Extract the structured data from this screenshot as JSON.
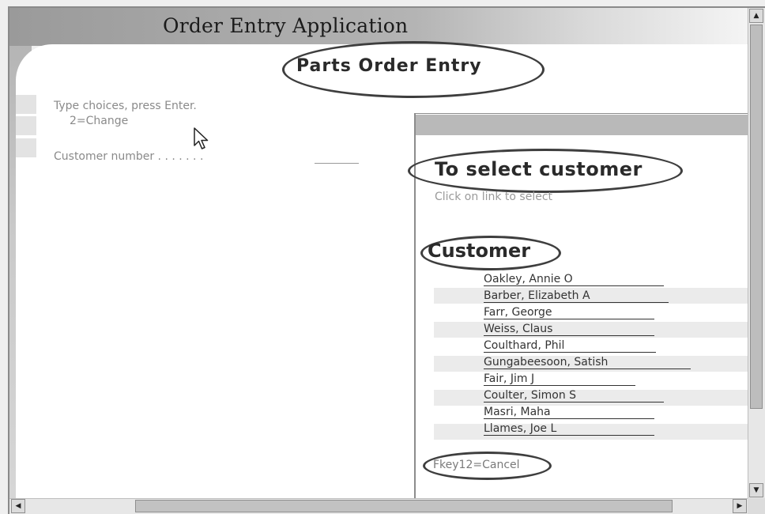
{
  "app": {
    "title": "Order Entry Application"
  },
  "screen": {
    "heading": "Parts Order Entry",
    "instruction1": "Type choices, press Enter.",
    "instruction2": "2=Change",
    "customer_number_label": "Customer number . . . . . . ."
  },
  "popup": {
    "heading": "To select customer",
    "instruction": "Click on link to select",
    "column_header": "Customer",
    "customers": [
      "Oakley, Annie O",
      "Barber, Elizabeth A",
      "Farr, George",
      "Weiss, Claus",
      "Coulthard, Phil",
      "Gungabeesoon, Satish",
      "Fair, Jim J",
      "Coulter, Simon S",
      "Masri, Maha",
      "Llames, Joe L"
    ],
    "fkey": "Fkey12=Cancel"
  },
  "icons": {
    "cursor": "arrow-cursor-icon",
    "scroll_up": "arrow-up-icon",
    "scroll_down": "arrow-down-icon",
    "scroll_left": "arrow-left-icon",
    "scroll_right": "arrow-right-icon"
  }
}
